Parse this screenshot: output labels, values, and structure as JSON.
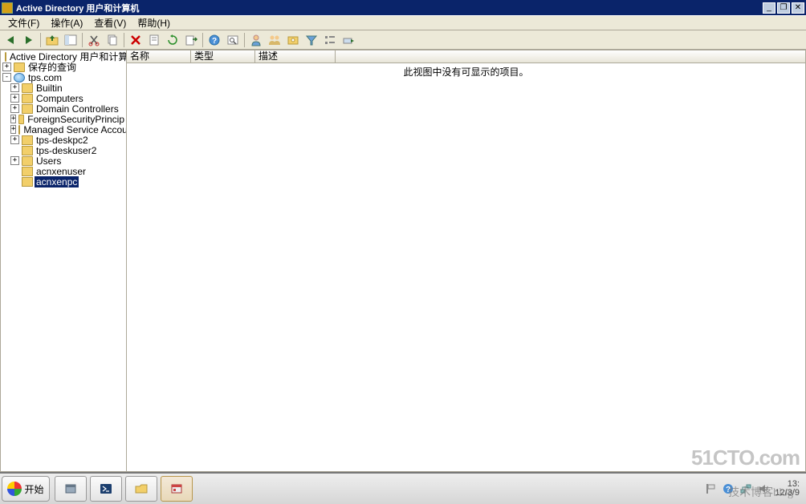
{
  "titlebar": {
    "title": "Active Directory 用户和计算机"
  },
  "menubar": {
    "file": "文件(F)",
    "action": "操作(A)",
    "view": "查看(V)",
    "help": "帮助(H)"
  },
  "toolbar_icons": {
    "back": "后退",
    "forward": "前进",
    "up": "上",
    "show_hide": "显示/隐藏",
    "cut": "剪切",
    "copy": "复制",
    "delete": "删除",
    "properties": "属性",
    "refresh": "刷新",
    "export": "导出列表",
    "help": "帮助",
    "find": "查找",
    "new_user": "新用户",
    "new_group": "新组",
    "new_ou": "新OU",
    "filter": "筛选",
    "view2": "视图",
    "more": "更多"
  },
  "tree": {
    "root": "Active Directory 用户和计算机",
    "saved_queries": "保存的查询",
    "domain": "tps.com",
    "nodes": {
      "builtin": "Builtin",
      "computers": "Computers",
      "domain_controllers": "Domain Controllers",
      "foreign": "ForeignSecurityPrincip",
      "managed": "Managed Service Accou",
      "deskpc2": "tps-deskpc2",
      "deskuser2": "tps-deskuser2",
      "users": "Users",
      "acnxenuser": "acnxenuser",
      "acnxenpc": "acnxenpc"
    }
  },
  "list": {
    "columns": {
      "name": "名称",
      "type": "类型",
      "desc": "描述"
    },
    "empty": "此视图中没有可显示的项目。"
  },
  "taskbar": {
    "start": "开始",
    "time": "13:",
    "date": "12/3/9"
  },
  "watermark": {
    "logo": "51CTO.com",
    "sub": "技术博客blog"
  }
}
